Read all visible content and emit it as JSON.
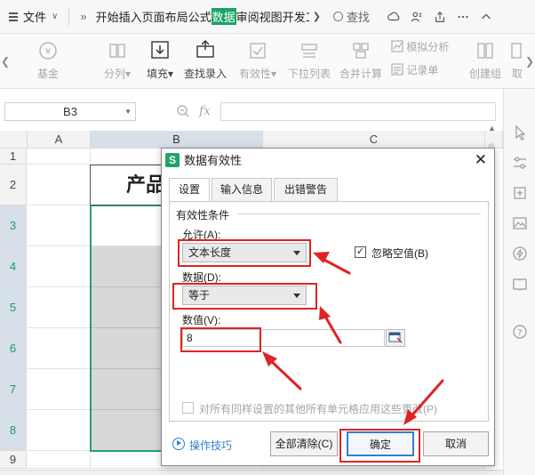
{
  "menubar": {
    "file_label": "文件",
    "tabs": [
      "开始",
      "插入",
      "页面布局",
      "公式",
      "数据",
      "审阅",
      "视图",
      "开发工具"
    ],
    "active_tab": "数据",
    "search_label": "查找"
  },
  "ribbon": {
    "items": [
      {
        "label": "基金",
        "icon": "fund-icon",
        "disabled": true
      },
      {
        "label": "分列",
        "icon": "split-column-icon",
        "disabled": true,
        "dropdown": true
      },
      {
        "label": "填充",
        "icon": "fill-icon",
        "disabled": false,
        "dropdown": true
      },
      {
        "label": "查找录入",
        "icon": "find-entry-icon",
        "disabled": false
      },
      {
        "label": "有效性",
        "icon": "validity-icon",
        "disabled": true,
        "dropdown": true
      },
      {
        "label": "下拉列表",
        "icon": "dropdown-list-icon",
        "disabled": true
      },
      {
        "label": "合并计算",
        "icon": "consolidate-icon",
        "disabled": true
      },
      {
        "label": "模拟分析",
        "icon": "what-if-icon",
        "disabled": true
      },
      {
        "label": "记录单",
        "icon": "record-form-icon",
        "disabled": true
      },
      {
        "label": "创建组",
        "icon": "create-group-icon",
        "disabled": true
      },
      {
        "label": "取",
        "icon": "ungroup-icon",
        "disabled": true
      }
    ]
  },
  "formula_bar": {
    "name_box": "B3",
    "fx_label": "fx",
    "formula_value": ""
  },
  "sheet": {
    "columns": [
      "A",
      "B",
      "C"
    ],
    "rows": [
      "1",
      "2",
      "3",
      "4",
      "5",
      "6",
      "7",
      "8",
      "9"
    ],
    "header_text": "产品"
  },
  "dialog": {
    "title": "数据有效性",
    "tabs": [
      "设置",
      "输入信息",
      "出错警告"
    ],
    "active_tab": "设置",
    "group_label": "有效性条件",
    "allow_label": "允许(A):",
    "allow_value": "文本长度",
    "ignore_blank_label": "忽略空值(B)",
    "ignore_blank_checked": true,
    "data_label": "数据(D):",
    "data_value": "等于",
    "value_label": "数值(V):",
    "value_input": "8",
    "apply_all_label": "对所有同样设置的其他所有单元格应用这些更改(P)",
    "apply_all_checked": false,
    "tips_link": "操作技巧",
    "clear_all_button": "全部清除(C)",
    "ok_button": "确定",
    "cancel_button": "取消"
  },
  "colors": {
    "accent_green": "#21a366",
    "annotation_red": "#e02323",
    "link_blue": "#2d7fd4"
  }
}
